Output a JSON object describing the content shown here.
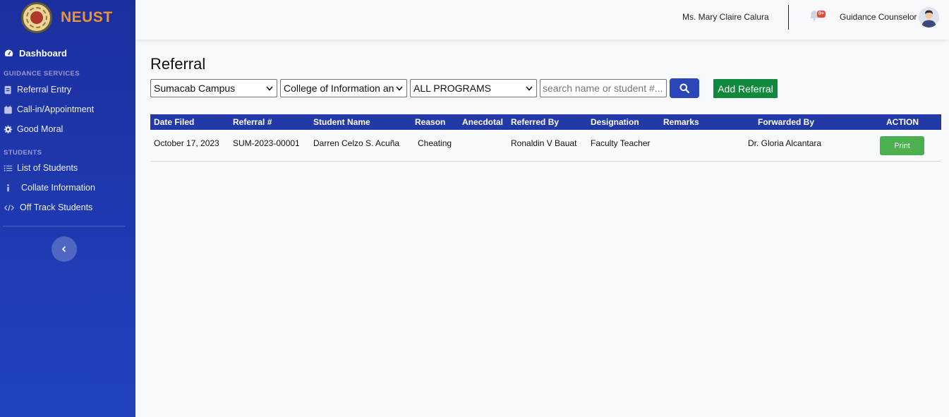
{
  "brand": {
    "name": "NEUST"
  },
  "sidebar": {
    "dashboard": "Dashboard",
    "sections": [
      {
        "heading": "GUIDANCE SERVICES",
        "items": [
          "Referral Entry",
          "Call-in/Appointment",
          "Good Moral"
        ]
      },
      {
        "heading": "STUDENTS",
        "items": [
          "List of Students",
          "Collate Information",
          "Off Track Students"
        ]
      }
    ]
  },
  "topbar": {
    "user_name": "Ms. Mary Claire Calura",
    "notification_badge": "0+",
    "role": "Guidance Counselor"
  },
  "page": {
    "title": "Referral",
    "filters": {
      "campus": "Sumacab Campus",
      "college": "College of Information and Communications Technology",
      "program": "ALL PROGRAMS"
    },
    "search": {
      "placeholder": "search name or student #..."
    },
    "add_button": "Add Referral"
  },
  "table": {
    "columns": [
      "Date Filed",
      "Referral #",
      "Student Name",
      "Reason",
      "Anecdotal",
      "Referred By",
      "Designation",
      "Remarks",
      "Forwarded By",
      "ACTION"
    ],
    "rows": [
      {
        "date_filed": "October 17, 2023",
        "referral_no": "SUM-2023-00001",
        "student_name": "Darren Celzo S. Acuña",
        "reason": "Cheating",
        "anecdotal": "",
        "referred_by": "Ronaldin V Bauat",
        "designation": "Faculty Teacher",
        "remarks": "",
        "forwarded_by": "Dr. Gloria Alcantara",
        "action": "Print"
      }
    ]
  },
  "colors": {
    "sidebar_top": "#1c2f9e",
    "sidebar_bottom": "#2143c0",
    "brand_text": "#f0932b",
    "table_header": "#2339a8",
    "add_button": "#0f8a3c",
    "print_button": "#4caf50",
    "search_button": "#2a46b8"
  },
  "icons": {
    "dashboard": "gauge-icon",
    "referral_entry": "id-card-icon",
    "appointment": "calendar-icon",
    "good_moral": "gear-icon",
    "list_students": "list-icon",
    "collate": "info-icon",
    "off_track": "code-icon",
    "toggle": "chevron-left-icon",
    "bell": "bell-icon",
    "search": "search-icon"
  }
}
